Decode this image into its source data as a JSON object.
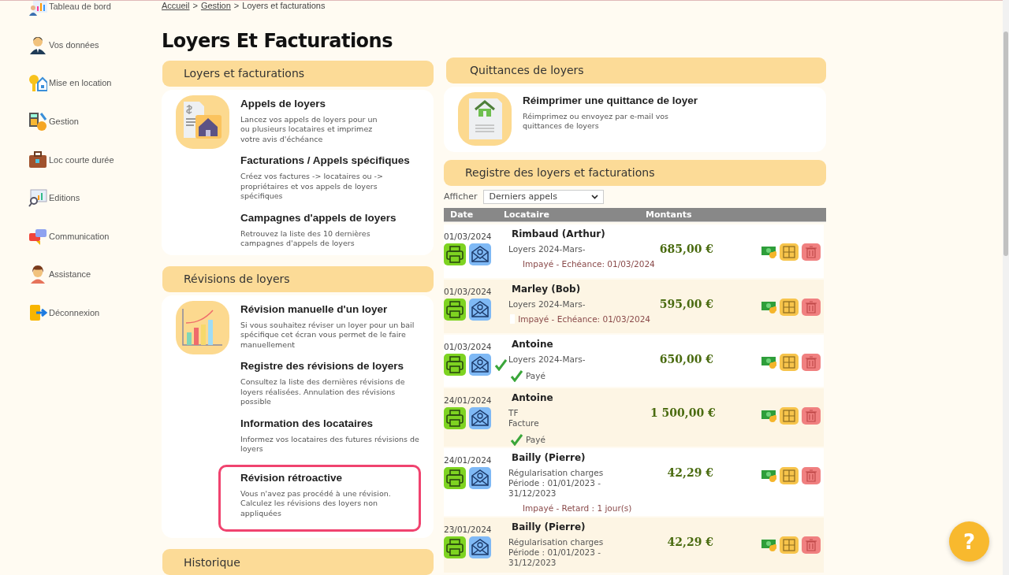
{
  "sidebar": {
    "items": [
      {
        "label": "Tableau de bord"
      },
      {
        "label": "Vos données"
      },
      {
        "label": "Mise en location"
      },
      {
        "label": "Gestion"
      },
      {
        "label": "Loc courte durée"
      },
      {
        "label": "Editions"
      },
      {
        "label": "Communication"
      },
      {
        "label": "Assistance"
      },
      {
        "label": "Déconnexion"
      }
    ]
  },
  "breadcrumb": {
    "separator": ">",
    "items": [
      {
        "label": "Accueil",
        "link": true
      },
      {
        "label": "Gestion",
        "link": true
      },
      {
        "label": "Loyers et facturations",
        "link": false
      }
    ]
  },
  "page_title": "Loyers Et Facturations",
  "left_sections": [
    {
      "title": "Loyers et facturations",
      "items": [
        {
          "heading": "Appels de loyers",
          "text": "Lancez vos appels de loyers pour un ou plusieurs locataires et imprimez votre avis d'échéance",
          "highlighted": false
        },
        {
          "heading": "Facturations / Appels spécifiques",
          "text": "Créez vos factures -> locataires ou -> propriétaires et vos appels de loyers spécifiques",
          "highlighted": false
        },
        {
          "heading": "Campagnes d'appels de loyers",
          "text": "Retrouvez la liste des 10 dernières campagnes d'appels de loyers",
          "highlighted": false
        }
      ]
    },
    {
      "title": "Révisions de loyers",
      "items": [
        {
          "heading": "Révision manuelle d'un loyer",
          "text": "Si vous souhaitez réviser un loyer pour un bail spécifique cet écran vous permet de le faire manuellement",
          "highlighted": false
        },
        {
          "heading": "Registre des révisions de loyers",
          "text": "Consultez la liste des dernières révisions de loyers réalisées. Annulation des révisions possible",
          "highlighted": false
        },
        {
          "heading": "Information des locataires",
          "text": "Informez vos locataires des futures révisions de loyers",
          "highlighted": false
        },
        {
          "heading": "Révision rétroactive",
          "text": "Vous n'avez pas procédé à une révision. Calculez les révisions des loyers non appliquées",
          "highlighted": true
        }
      ]
    },
    {
      "title": "Historique"
    }
  ],
  "receipts": {
    "title": "Quittances de loyers",
    "items": [
      {
        "heading": "Réimprimer une quittance de loyer",
        "text": "Réimprimez ou envoyez par e-mail vos quittances de loyers",
        "highlighted": false
      }
    ]
  },
  "register": {
    "title": "Registre des loyers et facturations",
    "filter": {
      "label": "Afficher",
      "value": "Derniers appels"
    },
    "columns": [
      "Date",
      "Locataire",
      "Montants"
    ],
    "rows": [
      {
        "date": "01/03/2024",
        "tenant": "Rimbaud (Arthur)",
        "lines": [
          "Loyers 2024-Mars-"
        ],
        "status": {
          "kind": "unpaid",
          "text": "Impayé - Echéance: 01/03/2024"
        },
        "sent": false,
        "amount": "685,00 €"
      },
      {
        "date": "01/03/2024",
        "tenant": "Marley (Bob)",
        "lines": [
          "Loyers 2024-Mars-"
        ],
        "status": {
          "kind": "unpaid-box",
          "text": "Impayé - Echéance: 01/03/2024"
        },
        "sent": false,
        "amount": "595,00 €"
      },
      {
        "date": "01/03/2024",
        "tenant": "Antoine",
        "lines": [
          "Loyers 2024-Mars-"
        ],
        "status": {
          "kind": "paid",
          "text": "Payé"
        },
        "sent": true,
        "amount": "650,00 €"
      },
      {
        "date": "24/01/2024",
        "tenant": "Antoine",
        "lines": [
          "TF",
          "Facture"
        ],
        "status": {
          "kind": "paid",
          "text": "Payé"
        },
        "sent": false,
        "amount": "1 500,00 €"
      },
      {
        "date": "24/01/2024",
        "tenant": "Bailly (Pierre)",
        "lines": [
          "Régularisation charges",
          "Période : 01/01/2023 -",
          "31/12/2023"
        ],
        "status": {
          "kind": "unpaid",
          "text": "Impayé - Retard : 1 jour(s)"
        },
        "sent": false,
        "amount": "42,29 €"
      },
      {
        "date": "23/01/2024",
        "tenant": "Bailly (Pierre)",
        "lines": [
          "Régularisation charges",
          "Période : 01/01/2023 -",
          "31/12/2023"
        ],
        "sent": false,
        "amount": "42,29 €"
      }
    ]
  },
  "help": {
    "label": "?"
  }
}
